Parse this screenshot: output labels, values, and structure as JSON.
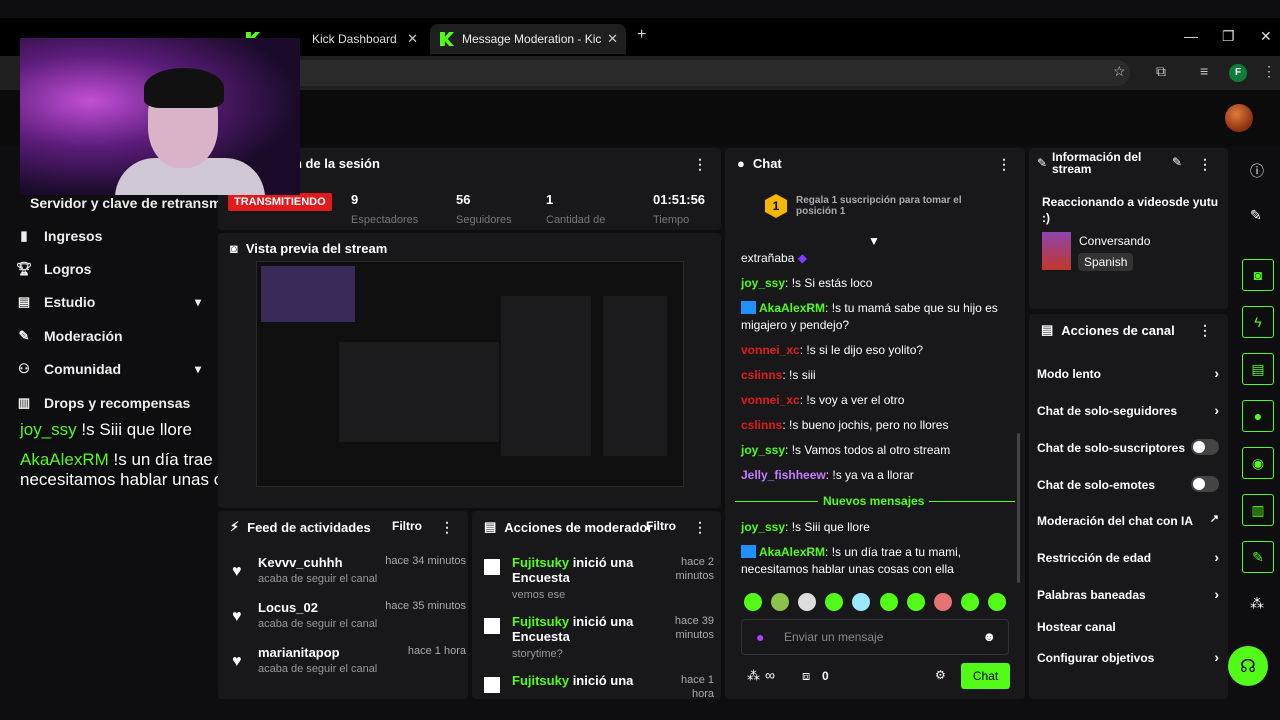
{
  "browser": {
    "tabs": [
      {
        "label": "Kick Dashboard"
      },
      {
        "label": "Message Moderation - Kick Das"
      }
    ],
    "new_tab": "+",
    "profile": "F"
  },
  "session": {
    "title": "ón de la sesión",
    "live_badge": "TRANSMITIENDO",
    "stats": [
      {
        "value": "9",
        "label": "Espectadores"
      },
      {
        "value": "56",
        "label": "Seguidores"
      },
      {
        "value": "1",
        "label": "Cantidad de"
      },
      {
        "value": "01:51:56",
        "label": "Tiempo"
      }
    ]
  },
  "sidebar": {
    "title": "Servidor y clave de retransm",
    "items": [
      {
        "label": "Ingresos",
        "icon": "dollar-icon"
      },
      {
        "label": "Logros",
        "icon": "trophy-icon"
      },
      {
        "label": "Estudio",
        "icon": "studio-icon"
      },
      {
        "label": "Moderación",
        "icon": "wrench-icon"
      },
      {
        "label": "Comunidad",
        "icon": "users-icon"
      },
      {
        "label": "Drops y recompensas",
        "icon": "chart-icon"
      }
    ]
  },
  "overlay_chat": [
    {
      "user": "joy_ssy",
      "text": " !s Siii que llore"
    },
    {
      "user": "AkaAlexRM",
      "text": " !s un día trae a tu mami,",
      "text2": "necesitamos hablar unas cosas con ella"
    }
  ],
  "preview": {
    "title": "Vista previa del stream"
  },
  "activity": {
    "title": "Feed de actividades",
    "filter": "Filtro",
    "items": [
      {
        "name": "Kevvv_cuhhh",
        "time": "hace 34 minutos",
        "sub": "acaba de seguir el canal"
      },
      {
        "name": "Locus_02",
        "time": "hace 35 minutos",
        "sub": "acaba de seguir el canal"
      },
      {
        "name": "marianitapop",
        "time": "hace 1 hora",
        "sub": "acaba de seguir el canal"
      }
    ]
  },
  "modactions": {
    "title": "Acciones de moderador",
    "filter": "Filtro",
    "items": [
      {
        "user": "Fujitsuky",
        "action": " inició una Encuesta",
        "time": "hace 2 minutos",
        "sub": "vemos ese"
      },
      {
        "user": "Fujitsuky",
        "action": " inició una Encuesta",
        "time": "hace 39 minutos",
        "sub": "storytime?"
      },
      {
        "user": "Fujitsuky",
        "action": " inició una",
        "time": "hace 1 hora",
        "sub": ""
      }
    ]
  },
  "chat": {
    "title": "Chat",
    "gift_rank": "1",
    "gift_text": "Regala 1 suscripción para tomar el posición 1",
    "new_messages": "Nuevos mensajes",
    "input_placeholder": "Enviar un mensaje",
    "send_label": "Chat",
    "infinity_label": "∞",
    "gift_count": "0",
    "messages": [
      {
        "user": "",
        "text": "extrañaba",
        "color": "#ffffff"
      },
      {
        "user": "joy_ssy",
        "text": ": !s Si estás loco",
        "color": "#53fc18"
      },
      {
        "user": "AkaAlexRM",
        "text": ": !s tu mamá sabe que su hijo es migajero y pendejo?",
        "color": "#53fc18",
        "badge": true
      },
      {
        "user": "vonnei_xc",
        "text": ": !s si le dijo eso yolito?",
        "color": "#e11b1b"
      },
      {
        "user": "cslinns",
        "text": ": !s siii",
        "color": "#e11b1b"
      },
      {
        "user": "vonnei_xc",
        "text": ": !s voy a ver el otro",
        "color": "#e11b1b"
      },
      {
        "user": "cslinns",
        "text": ": !s bueno jochis, pero no llores",
        "color": "#e11b1b"
      },
      {
        "user": "joy_ssy",
        "text": ": !s Vamos todos al otro stream",
        "color": "#53fc18"
      },
      {
        "user": "Jelly_fishheew",
        "text": ": !s ya va a llorar",
        "color": "#c77dff"
      },
      {
        "user": "joy_ssy",
        "text": ": !s Siii que llore",
        "color": "#53fc18"
      },
      {
        "user": "AkaAlexRM",
        "text": ": !s un día trae a tu mami, necesitamos hablar unas cosas con ella",
        "color": "#53fc18",
        "badge": true
      }
    ]
  },
  "stream_info": {
    "title": "Información del stream",
    "stream_title": "Reaccionando a videosde yutu :)",
    "category": "Conversando",
    "language": "Spanish"
  },
  "channel_actions": {
    "title": "Acciones de canal",
    "items": [
      {
        "label": "Modo lento",
        "kind": "arrow"
      },
      {
        "label": "Chat de solo-seguidores",
        "kind": "arrow"
      },
      {
        "label": "Chat de solo-suscriptores",
        "kind": "toggle"
      },
      {
        "label": "Chat de solo-emotes",
        "kind": "toggle"
      },
      {
        "label": "Moderación del chat con IA",
        "kind": "external"
      },
      {
        "label": "Restricción de edad",
        "kind": "arrow"
      },
      {
        "label": "Palabras baneadas",
        "kind": "arrow"
      },
      {
        "label": "Hostear canal",
        "kind": "none"
      },
      {
        "label": "Configurar objetivos",
        "kind": "arrow"
      }
    ]
  },
  "colors": {
    "accent": "#53fc18",
    "live": "#e11b1b",
    "panel": "#18181b"
  }
}
